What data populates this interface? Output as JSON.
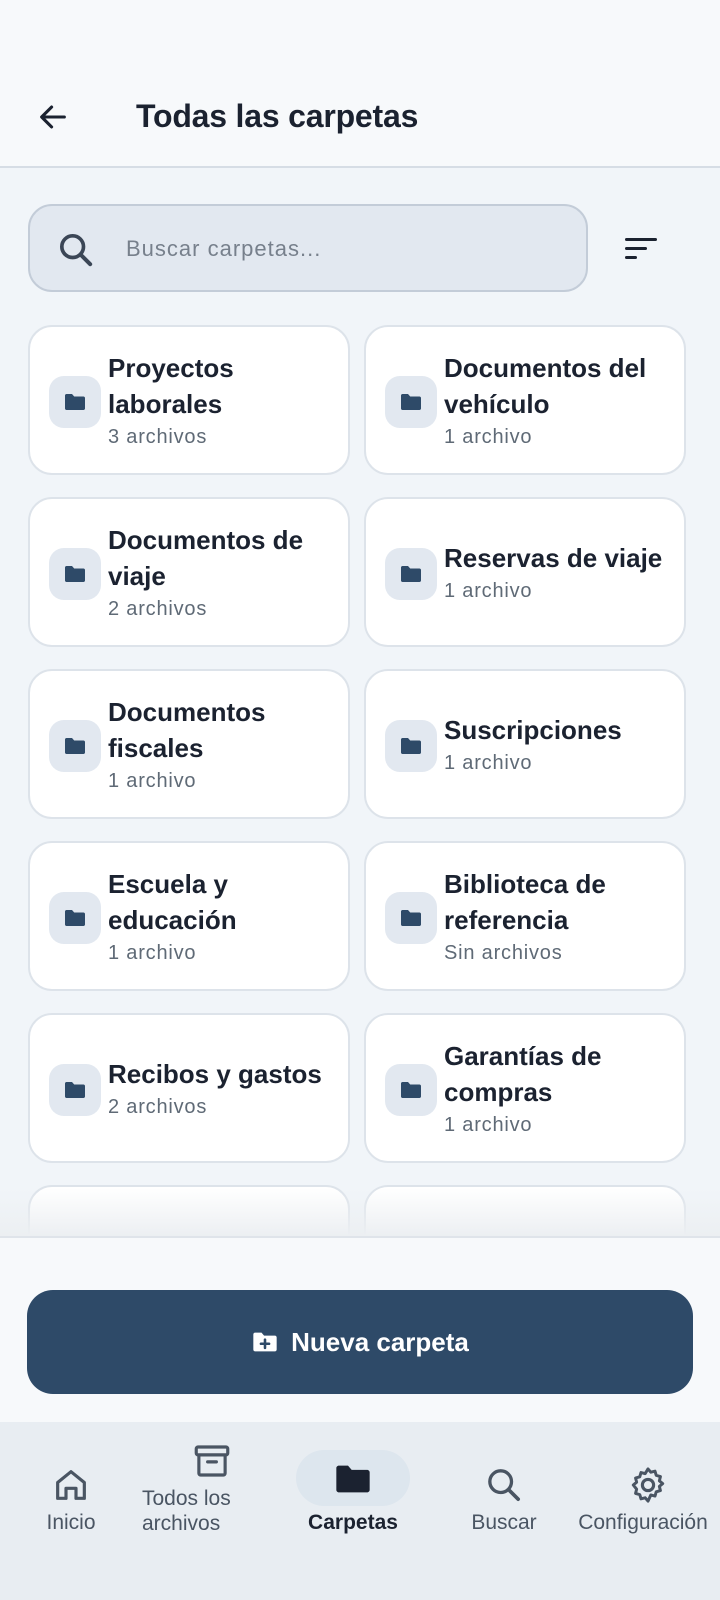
{
  "header": {
    "title": "Todas las carpetas"
  },
  "search": {
    "placeholder": "Buscar carpetas..."
  },
  "folders": [
    {
      "name": "Proyectos laborales",
      "count": "3 archivos"
    },
    {
      "name": "Documentos del vehículo",
      "count": "1 archivo"
    },
    {
      "name": "Documentos de viaje",
      "count": "2 archivos"
    },
    {
      "name": "Reservas de viaje",
      "count": "1 archivo"
    },
    {
      "name": "Documentos fiscales",
      "count": "1 archivo"
    },
    {
      "name": "Suscripciones",
      "count": "1 archivo"
    },
    {
      "name": "Escuela y educación",
      "count": "1 archivo"
    },
    {
      "name": "Biblioteca de referencia",
      "count": "Sin archivos"
    },
    {
      "name": "Recibos y gastos",
      "count": "2 archivos"
    },
    {
      "name": "Garantías de compras",
      "count": "1 archivo"
    }
  ],
  "actions": {
    "new_folder": "Nueva carpeta"
  },
  "nav": {
    "items": [
      {
        "label": "Inicio",
        "icon": "home-icon"
      },
      {
        "label": "Todos los archivos",
        "icon": "archive-icon"
      },
      {
        "label": "Carpetas",
        "icon": "folder-icon",
        "active": true
      },
      {
        "label": "Buscar",
        "icon": "search-icon"
      },
      {
        "label": "Configuración",
        "icon": "gear-icon"
      }
    ]
  },
  "colors": {
    "primary": "#2e4a68",
    "folder_icon": "#2e4a68",
    "background": "#f1f5f9",
    "card": "#ffffff"
  }
}
